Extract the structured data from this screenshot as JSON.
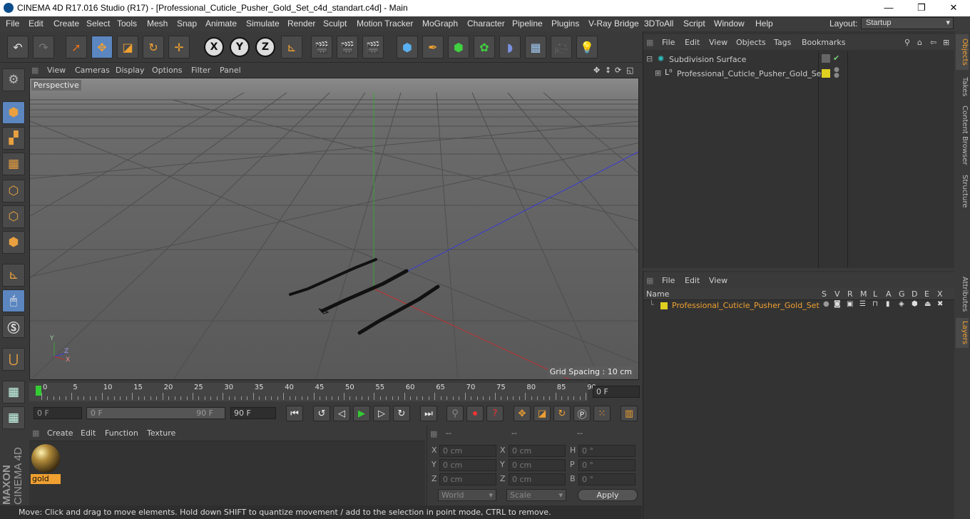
{
  "window": {
    "title": "CINEMA 4D R17.016 Studio (R17) - [Professional_Cuticle_Pusher_Gold_Set_c4d_standart.c4d] - Main",
    "minimize": "—",
    "maximize": "❐",
    "close": "✕"
  },
  "menubar": {
    "items": [
      "File",
      "Edit",
      "Create",
      "Select",
      "Tools",
      "Mesh",
      "Snap",
      "Animate",
      "Simulate",
      "Render",
      "Sculpt",
      "Motion Tracker",
      "MoGraph",
      "Character",
      "Pipeline",
      "Plugins",
      "V-Ray Bridge",
      "3DToAll",
      "Script",
      "Window",
      "Help"
    ],
    "layout_label": "Layout:",
    "layout_value": "Startup"
  },
  "toolbar": {
    "axis_x": "X",
    "axis_y": "Y",
    "axis_z": "Z"
  },
  "viewport": {
    "menu": [
      "View",
      "Cameras",
      "Display",
      "Options",
      "Filter",
      "Panel"
    ],
    "label": "Perspective",
    "grid_spacing": "Grid Spacing : 10 cm",
    "axis_y": "Y",
    "axis_z": "Z",
    "axis_x": "X"
  },
  "timeline": {
    "ticks": [
      "0",
      "5",
      "10",
      "15",
      "20",
      "25",
      "30",
      "35",
      "40",
      "45",
      "50",
      "55",
      "60",
      "65",
      "70",
      "75",
      "80",
      "85",
      "90"
    ],
    "current_frame": "0 F"
  },
  "playbar": {
    "start": "0 F",
    "range_start": "0 F",
    "range_end": "90 F",
    "end": "90 F"
  },
  "materials": {
    "menu": [
      "Create",
      "Edit",
      "Function",
      "Texture"
    ],
    "items": [
      {
        "name": "gold"
      }
    ]
  },
  "coordinates": {
    "headers": [
      "--",
      "--",
      "--"
    ],
    "rows": [
      {
        "l1": "X",
        "v1": "0 cm",
        "l2": "X",
        "v2": "0 cm",
        "l3": "H",
        "v3": "0 °"
      },
      {
        "l1": "Y",
        "v1": "0 cm",
        "l2": "Y",
        "v2": "0 cm",
        "l3": "P",
        "v3": "0 °"
      },
      {
        "l1": "Z",
        "v1": "0 cm",
        "l2": "Z",
        "v2": "0 cm",
        "l3": "B",
        "v3": "0 °"
      }
    ],
    "mode1": "World",
    "mode2": "Scale",
    "apply": "Apply"
  },
  "object_manager": {
    "menu": [
      "File",
      "Edit",
      "View",
      "Objects",
      "Tags",
      "Bookmarks"
    ],
    "objects": [
      {
        "name": "Subdivision Surface",
        "color": "#2ec0c0"
      },
      {
        "name": "Professional_Cuticle_Pusher_Gold_Set",
        "color": "#e0d020"
      }
    ]
  },
  "layer_manager": {
    "menu": [
      "File",
      "Edit",
      "View"
    ],
    "columns": [
      "Name",
      "S",
      "V",
      "R",
      "M",
      "L",
      "A",
      "G",
      "D",
      "E",
      "X"
    ],
    "layers": [
      {
        "name": "Professional_Cuticle_Pusher_Gold_Set",
        "color": "#e0d020"
      }
    ]
  },
  "right_tabs": [
    "Objects",
    "Takes",
    "Content Browser",
    "Structure",
    "Attributes",
    "Layers"
  ],
  "brand": {
    "maxon": "MAXON",
    "product": "CINEMA 4D"
  },
  "status": "Move: Click and drag to move elements. Hold down SHIFT to quantize movement / add to the selection in point mode, CTRL to remove."
}
